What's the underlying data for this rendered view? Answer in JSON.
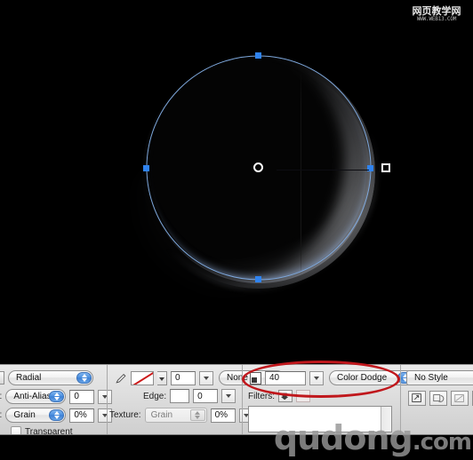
{
  "app": {
    "canvas_background": "#000000",
    "panel_background": "#dcdcdc",
    "accent_blue": "#2f83f0",
    "annotation_color": "#c0171c"
  },
  "watermarks": {
    "top": {
      "cn_text": "网页教学网",
      "url_text": "WWW.WEB13.COM"
    },
    "bottom": {
      "name": "qudong",
      "tld": ".com"
    }
  },
  "canvas": {
    "artwork_name": "gradient-sphere",
    "path_name": "circle-vector-path",
    "center_marker_name": "gradient-center-handle",
    "radius_handle_name": "gradient-radius-handle"
  },
  "options_bar": {
    "fill_group": {
      "gradient_type": "Radial",
      "edge_label": "e:",
      "edge_mode": "Anti-Alias",
      "edge_value": "0",
      "texture_label": "e:",
      "texture_type": "Grain",
      "texture_value": "0%",
      "transparent_label": "Transparent",
      "transparent_checked": false
    },
    "stroke_group": {
      "pencil_icon_name": "pencil-tool-icon",
      "stroke_swatch_name": "stroke-color-none-swatch",
      "stroke_size": "0",
      "stroke_style": "None",
      "edge_label": "Edge:",
      "edge_swatch_value": "",
      "edge_value": "0",
      "texture_label": "Texture:",
      "texture_type": "Grain",
      "texture_value": "0%"
    },
    "blend_group": {
      "opacity_icon_name": "opacity-icon",
      "opacity_value": "40",
      "blend_mode": "Color Dodge",
      "filters_label": "Filters:",
      "filters_list_items": []
    },
    "style_group": {
      "style_name": "No Style",
      "buttons": [
        "apply-style-button",
        "reset-style-button",
        "clear-style-button",
        "more-style-button"
      ]
    }
  }
}
